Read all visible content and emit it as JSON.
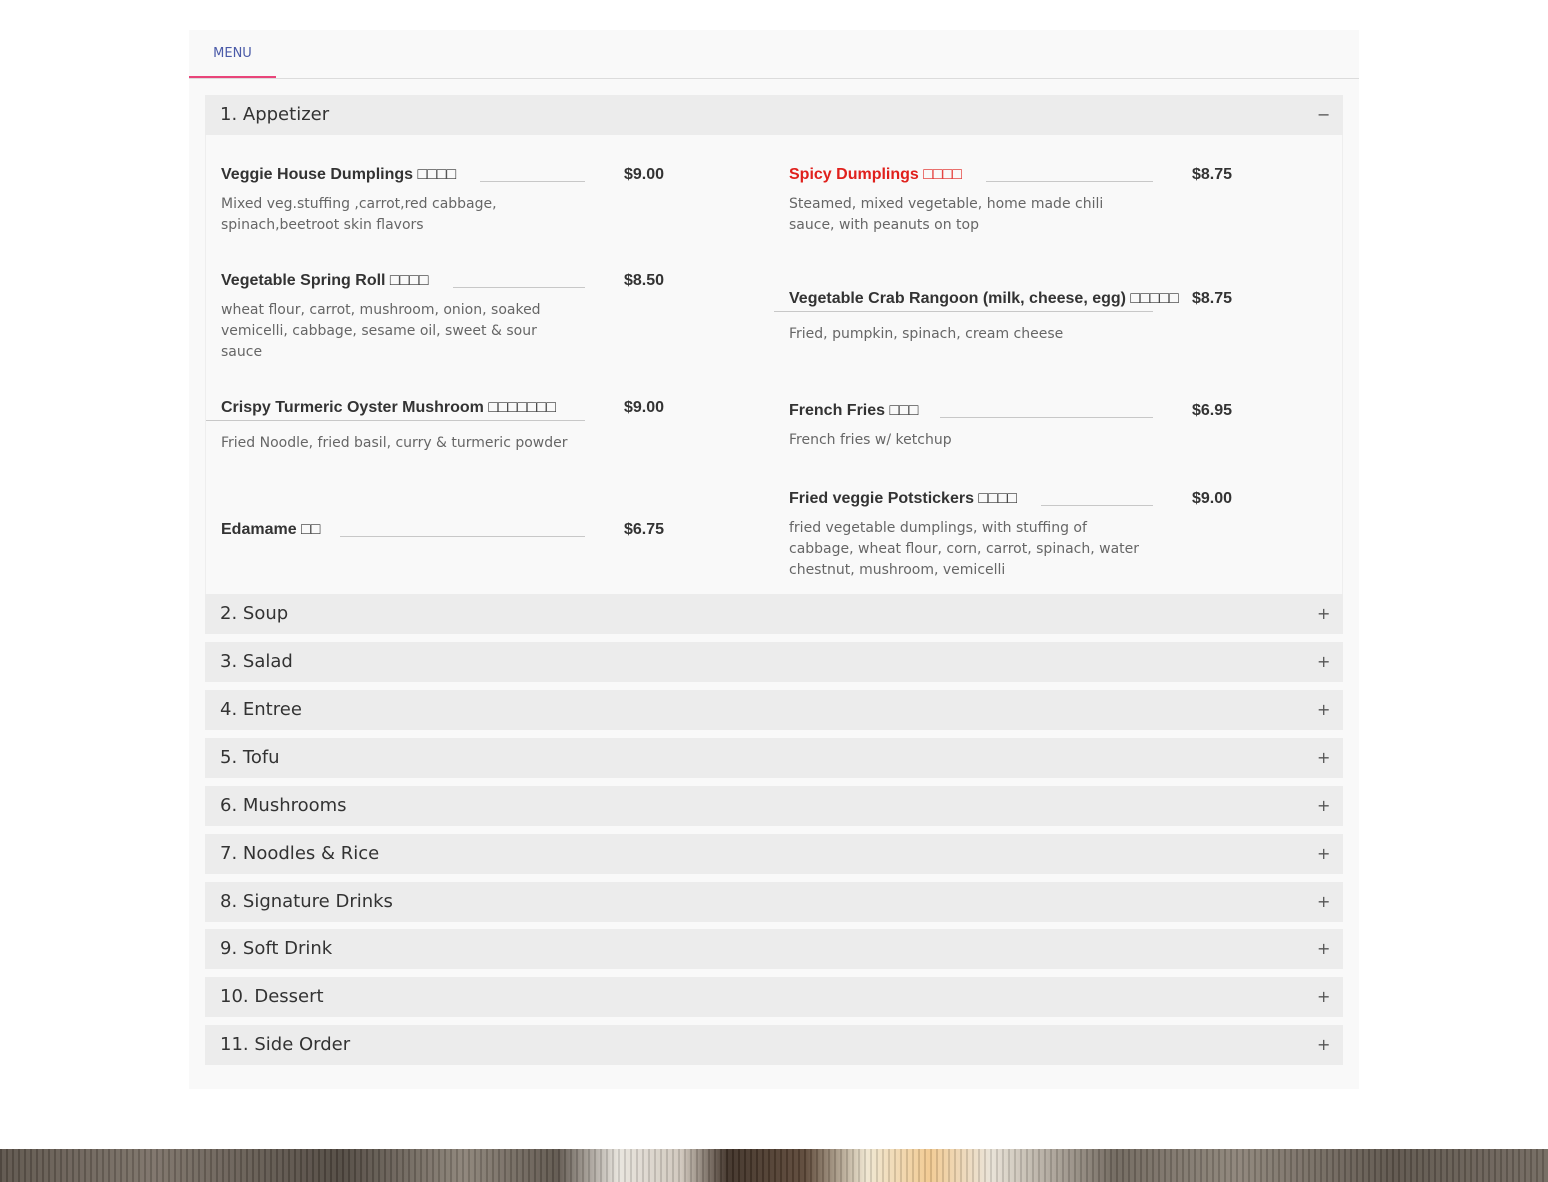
{
  "tabs": [
    {
      "label": "MENU"
    }
  ],
  "sections": [
    {
      "title": "1. Appetizer",
      "toggle": "−"
    },
    {
      "title": "2. Soup",
      "toggle": "+"
    },
    {
      "title": "3. Salad",
      "toggle": "+"
    },
    {
      "title": "4. Entree",
      "toggle": "+"
    },
    {
      "title": "5. Tofu",
      "toggle": "+"
    },
    {
      "title": "6. Mushrooms",
      "toggle": "+"
    },
    {
      "title": "7. Noodles & Rice",
      "toggle": "+"
    },
    {
      "title": "8. Signature Drinks",
      "toggle": "+"
    },
    {
      "title": "9. Soft Drink",
      "toggle": "+"
    },
    {
      "title": "10. Dessert",
      "toggle": "+"
    },
    {
      "title": "11. Side Order",
      "toggle": "+"
    }
  ],
  "appetizer_items": [
    {
      "name": "Veggie House Dumplings □□□□",
      "price": "$9.00",
      "desc": "Mixed veg.stuffing ,carrot,red cabbage, spinach,beetroot skin flavors"
    },
    {
      "name": "Spicy Dumplings □□□□",
      "price": "$8.75",
      "desc": "Steamed, mixed vegetable, home made chili sauce, with peanuts on top",
      "highlight_color": "#e0201c"
    },
    {
      "name": "Vegetable Spring Roll □□□□",
      "price": "$8.50",
      "desc": "wheat flour, carrot, mushroom, onion, soaked vemicelli, cabbage, sesame oil, sweet & sour sauce"
    },
    {
      "name": "Vegetable Crab Rangoon (milk, cheese, egg) □□□□□",
      "price": "$8.75",
      "desc": "Fried, pumpkin, spinach, cream cheese"
    },
    {
      "name": "Crispy Turmeric Oyster Mushroom □□□□□□□",
      "price": "$9.00",
      "desc": "Fried Noodle, fried basil, curry & turmeric powder"
    },
    {
      "name": "French Fries □□□",
      "price": "$6.95",
      "desc": "French fries w/ ketchup"
    },
    {
      "name": "Edamame □□",
      "price": "$6.75",
      "desc": ""
    },
    {
      "name": "Fried veggie Potstickers □□□□",
      "price": "$9.00",
      "desc": "fried vegetable dumplings, with stuffing of cabbage, wheat flour, corn, carrot, spinach, water chestnut, mushroom, vemicelli"
    }
  ],
  "colors": {
    "accent": "#e9457a",
    "tab_text": "#4a5aa8",
    "highlight": "#e0201c"
  }
}
